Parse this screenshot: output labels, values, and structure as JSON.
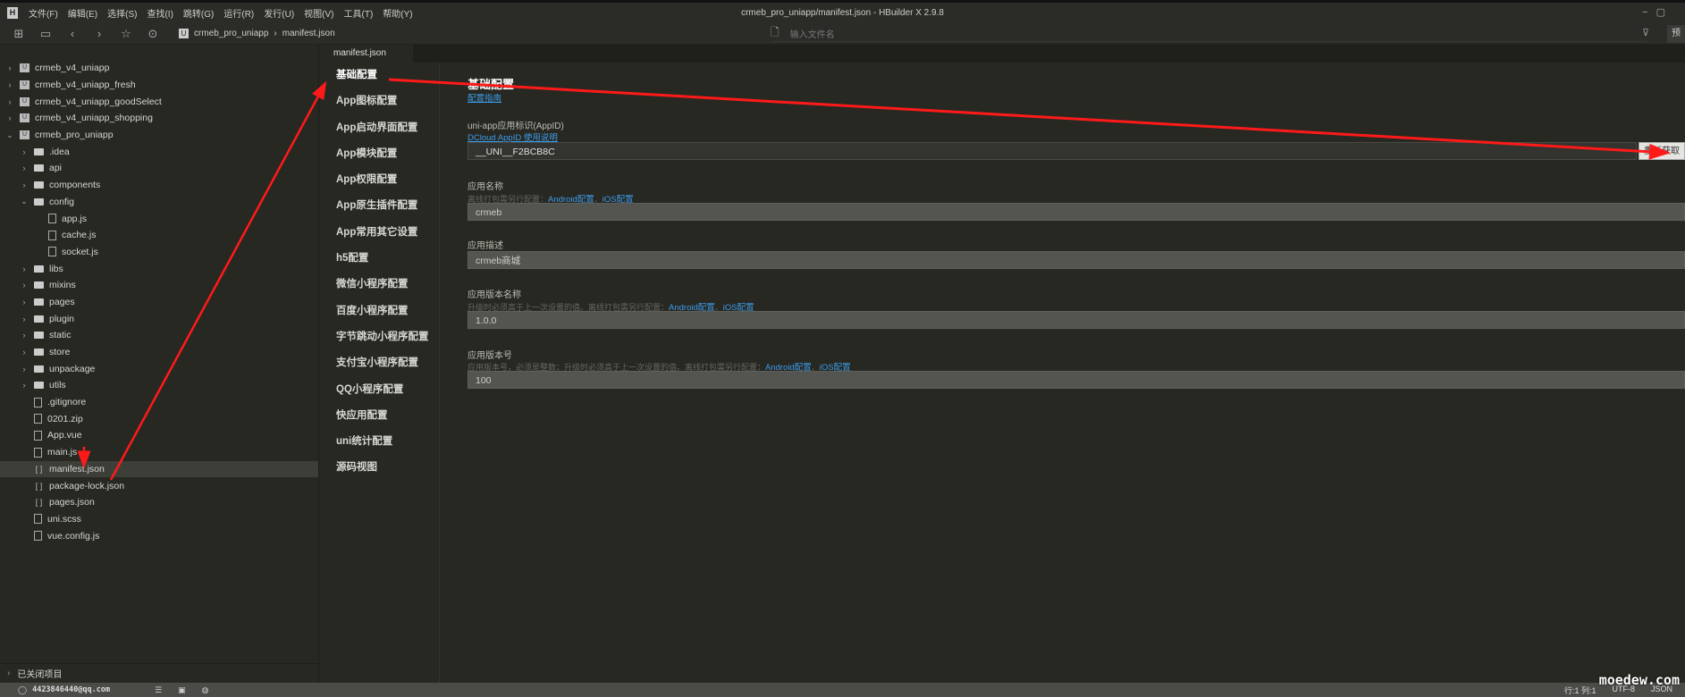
{
  "window": {
    "title": "crmeb_pro_uniapp/manifest.json - HBuilder X 2.9.8",
    "logo": "H",
    "minimize": "−",
    "restore": "▢"
  },
  "menu": [
    "文件(F)",
    "编辑(E)",
    "选择(S)",
    "查找(I)",
    "跳转(G)",
    "运行(R)",
    "发行(U)",
    "视图(V)",
    "工具(T)",
    "帮助(Y)"
  ],
  "toolbar": {
    "icons": [
      "new-file-icon",
      "save-icon",
      "back-icon",
      "forward-icon",
      "star-icon",
      "run-icon"
    ],
    "glyphs": [
      "⊞",
      "▭",
      "‹",
      "›",
      "☆",
      "⊙"
    ],
    "breadcrumb": [
      "crmeb_pro_uniapp",
      "manifest.json"
    ],
    "search_placeholder": "输入文件名",
    "preview_label": "预"
  },
  "tree": [
    {
      "label": "crmeb_v4_uniapp",
      "level": 0,
      "type": "proj",
      "chev": "›"
    },
    {
      "label": "crmeb_v4_uniapp_fresh",
      "level": 0,
      "type": "proj",
      "chev": "›"
    },
    {
      "label": "crmeb_v4_uniapp_goodSelect",
      "level": 0,
      "type": "proj",
      "chev": "›"
    },
    {
      "label": "crmeb_v4_uniapp_shopping",
      "level": 0,
      "type": "proj",
      "chev": "›"
    },
    {
      "label": "crmeb_pro_uniapp",
      "level": 0,
      "type": "proj",
      "chev": "⌄"
    },
    {
      "label": ".idea",
      "level": 1,
      "type": "folder",
      "chev": "›"
    },
    {
      "label": "api",
      "level": 1,
      "type": "folder",
      "chev": "›"
    },
    {
      "label": "components",
      "level": 1,
      "type": "folder",
      "chev": "›"
    },
    {
      "label": "config",
      "level": 1,
      "type": "folder",
      "chev": "⌄"
    },
    {
      "label": "app.js",
      "level": 2,
      "type": "file",
      "chev": ""
    },
    {
      "label": "cache.js",
      "level": 2,
      "type": "file",
      "chev": ""
    },
    {
      "label": "socket.js",
      "level": 2,
      "type": "file",
      "chev": ""
    },
    {
      "label": "libs",
      "level": 1,
      "type": "folder",
      "chev": "›"
    },
    {
      "label": "mixins",
      "level": 1,
      "type": "folder",
      "chev": "›"
    },
    {
      "label": "pages",
      "level": 1,
      "type": "folder",
      "chev": "›"
    },
    {
      "label": "plugin",
      "level": 1,
      "type": "folder",
      "chev": "›"
    },
    {
      "label": "static",
      "level": 1,
      "type": "folder",
      "chev": "›"
    },
    {
      "label": "store",
      "level": 1,
      "type": "folder",
      "chev": "›"
    },
    {
      "label": "unpackage",
      "level": 1,
      "type": "folder",
      "chev": "›"
    },
    {
      "label": "utils",
      "level": 1,
      "type": "folder",
      "chev": "›"
    },
    {
      "label": ".gitignore",
      "level": 1,
      "type": "file",
      "chev": ""
    },
    {
      "label": "0201.zip",
      "level": 1,
      "type": "file",
      "chev": ""
    },
    {
      "label": "App.vue",
      "level": 1,
      "type": "file",
      "chev": ""
    },
    {
      "label": "main.js",
      "level": 1,
      "type": "file",
      "chev": ""
    },
    {
      "label": "manifest.json",
      "level": 1,
      "type": "json",
      "chev": "",
      "selected": true
    },
    {
      "label": "package-lock.json",
      "level": 1,
      "type": "json",
      "chev": ""
    },
    {
      "label": "pages.json",
      "level": 1,
      "type": "json",
      "chev": ""
    },
    {
      "label": "uni.scss",
      "level": 1,
      "type": "file",
      "chev": ""
    },
    {
      "label": "vue.config.js",
      "level": 1,
      "type": "file",
      "chev": ""
    }
  ],
  "closed_projects": "已关闭项目",
  "tab": "manifest.json",
  "nav": [
    "基础配置",
    "App图标配置",
    "App启动界面配置",
    "App模块配置",
    "App权限配置",
    "App原生插件配置",
    "App常用其它设置",
    "h5配置",
    "微信小程序配置",
    "百度小程序配置",
    "字节跳动小程序配置",
    "支付宝小程序配置",
    "QQ小程序配置",
    "快应用配置",
    "uni统计配置",
    "源码视图"
  ],
  "form": {
    "title": "基础配置",
    "guide": "配置指南",
    "appid_label": "uni-app应用标识(AppID)",
    "appid_link": "DCloud AppID 使用说明",
    "appid": "__UNI__F2BCB8C",
    "refresh": "重新获取",
    "name_label": "应用名称",
    "name_hint": "离线打包需另行配置：",
    "name": "crmeb",
    "desc_label": "应用描述",
    "desc": "crmeb商城",
    "vname_label": "应用版本名称",
    "vname_hint": "升级时必须高于上一次设置的值。离线打包需另行配置：",
    "vname": "1.0.0",
    "vcode_label": "应用版本号",
    "vcode_hint": "应用版本号，必须是整数；升级时必须高于上一次设置的值。离线打包需另行配置：",
    "vcode": "100",
    "android": "Android配置",
    "ios": "iOS配置",
    "sep": "、"
  },
  "status": {
    "user": "4423846440@qq.com",
    "pos": "行:1  列:1",
    "encoding": "UTF-8",
    "lang": "JSON"
  },
  "watermark": "moedew.com",
  "colors": {
    "arrow": "#ff1a1a",
    "link": "#3d9be9"
  }
}
